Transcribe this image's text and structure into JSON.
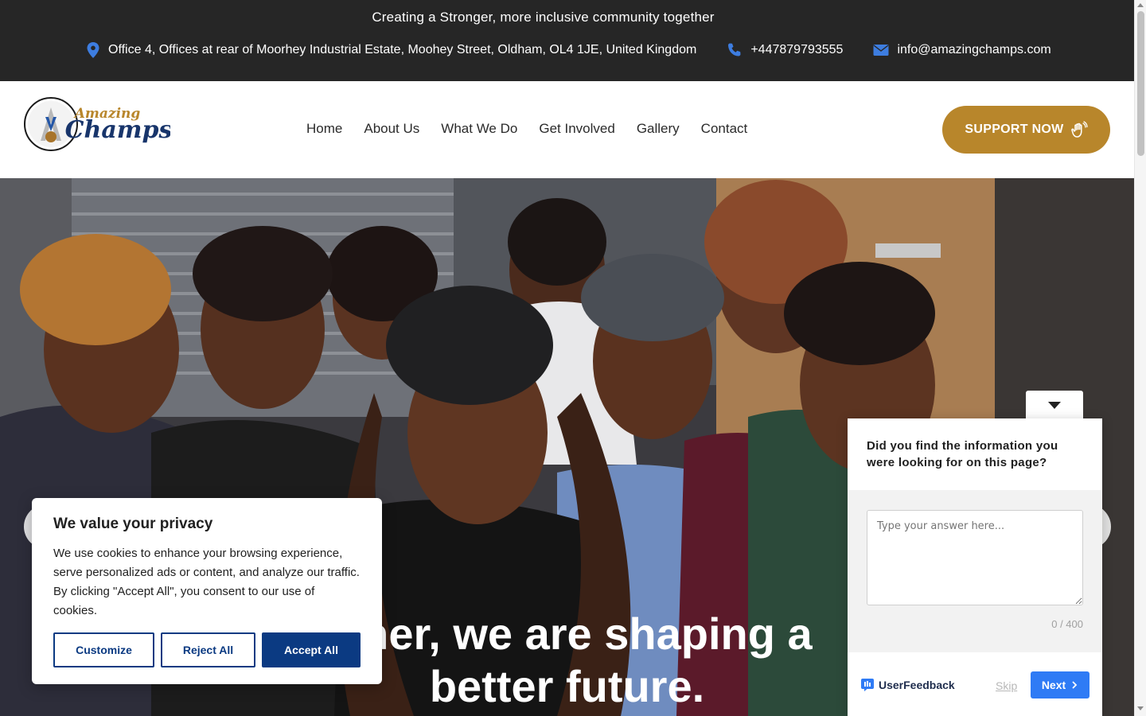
{
  "topbar": {
    "tagline": "Creating a Stronger, more inclusive community together",
    "address": "Office 4, Offices at rear of Moorhey Industrial Estate, Moohey Street, Oldham, OL4 1JE, United Kingdom",
    "phone": "+447879793555",
    "email": "info@amazingchamps.com"
  },
  "logo": {
    "line1": "Amazing",
    "line2": "Champs"
  },
  "nav": [
    {
      "label": "Home"
    },
    {
      "label": "About Us"
    },
    {
      "label": "What We Do"
    },
    {
      "label": "Get Involved"
    },
    {
      "label": "Gallery"
    },
    {
      "label": "Contact"
    }
  ],
  "support_button": {
    "label": "SUPPORT NOW"
  },
  "hero": {
    "heading_line1": "ether, we are shaping a",
    "heading_line2": "better future."
  },
  "cookie": {
    "title": "We value your privacy",
    "body": "We use cookies to enhance your browsing experience, serve personalized ads or content, and analyze our traffic. By clicking \"Accept All\", you consent to our use of cookies.",
    "customize": "Customize",
    "reject": "Reject All",
    "accept": "Accept All"
  },
  "feedback": {
    "question": "Did you find the information you were looking for on this page?",
    "placeholder": "Type your answer here...",
    "counter": "0 / 400",
    "brand": "UserFeedback",
    "skip": "Skip",
    "next": "Next"
  },
  "colors": {
    "accent": "#b8862b",
    "topbar": "#262626",
    "cookie_primary": "#0b3a82",
    "feedback_button": "#2f7bf5"
  }
}
